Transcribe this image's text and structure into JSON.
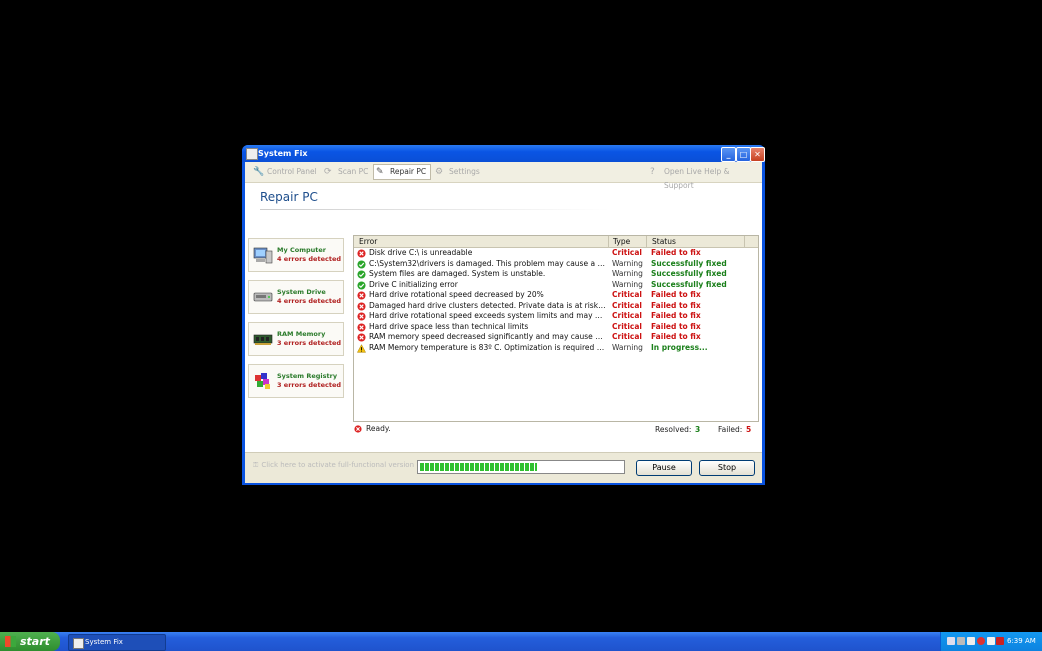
{
  "window": {
    "title": "System Fix"
  },
  "toolbar": {
    "items": [
      {
        "label": "Control Panel",
        "icon": "control-panel-icon"
      },
      {
        "label": "Scan PC",
        "icon": "scan-icon"
      },
      {
        "label": "Repair PC",
        "icon": "repair-icon",
        "active": true
      },
      {
        "label": "Settings",
        "icon": "settings-icon"
      }
    ],
    "help": "Open Live Help & Support"
  },
  "heading": "Repair PC",
  "sidebar": [
    {
      "name": "My Computer",
      "errors": "4 errors detected",
      "icon": "computer-icon"
    },
    {
      "name": "System Drive",
      "errors": "4 errors detected",
      "icon": "drive-icon"
    },
    {
      "name": "RAM Memory",
      "errors": "3 errors detected",
      "icon": "ram-icon"
    },
    {
      "name": "System Registry",
      "errors": "3 errors detected",
      "icon": "registry-icon"
    }
  ],
  "table": {
    "headers": [
      "Error",
      "Type",
      "Status"
    ],
    "rows": [
      {
        "icon": "error",
        "error": "Disk drive C:\\ is unreadable",
        "type": "Critical",
        "status": "Failed to fix"
      },
      {
        "icon": "ok",
        "error": "C:\\System32\\drivers is damaged. This problem may cause a sys...",
        "type": "Warning",
        "status": "Successfully fixed"
      },
      {
        "icon": "ok",
        "error": "System files are damaged. System is unstable.",
        "type": "Warning",
        "status": "Successfully fixed"
      },
      {
        "icon": "ok",
        "error": "Drive C initializing error",
        "type": "Warning",
        "status": "Successfully fixed"
      },
      {
        "icon": "error",
        "error": "Hard drive rotational speed decreased by 20%",
        "type": "Critical",
        "status": "Failed to fix"
      },
      {
        "icon": "error",
        "error": "Damaged hard drive clusters detected. Private data is at risk. Re...",
        "type": "Critical",
        "status": "Failed to fix"
      },
      {
        "icon": "error",
        "error": "Hard drive rotational speed exceeds system limits and may caus...",
        "type": "Critical",
        "status": "Failed to fix"
      },
      {
        "icon": "error",
        "error": "Hard drive space less than technical limits",
        "type": "Critical",
        "status": "Failed to fix"
      },
      {
        "icon": "error",
        "error": "RAM memory speed decreased significantly and may cause a sys...",
        "type": "Critical",
        "status": "Failed to fix"
      },
      {
        "icon": "warning",
        "error": "RAM Memory temperature is 83º C. Optimization is required for ...",
        "type": "Warning",
        "status": "In progress..."
      }
    ]
  },
  "status": {
    "text": "Ready.",
    "resolved_label": "Resolved:",
    "resolved": "3",
    "failed_label": "Failed:",
    "failed": "5"
  },
  "bottom": {
    "activate": "Click here to activate full-functional version",
    "progress": 0.58,
    "pause": "Pause",
    "stop": "Stop"
  },
  "taskbar": {
    "start": "start",
    "task": "System Fix",
    "clock": "6:39 AM"
  },
  "colors": {
    "critical": "#cc1111",
    "warning": "#333333",
    "failed": "#cc1111",
    "fixed": "#1a7f1a",
    "in_progress": "#1a7f1a"
  }
}
